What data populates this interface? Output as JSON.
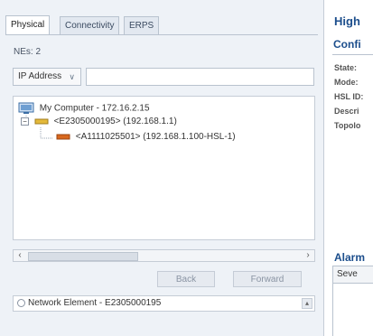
{
  "tabs": [
    {
      "label": "Physical"
    },
    {
      "label": "Connectivity"
    },
    {
      "label": "ERPS"
    }
  ],
  "nes_count": "NEs: 2",
  "filter": {
    "field": "IP Address",
    "value": ""
  },
  "tree": {
    "root": "My Computer - 172.16.2.15",
    "child": "<E2305000195> (192.168.1.1)",
    "grandchild": "<A1111025501> (192.168.1.100-HSL-1)"
  },
  "nav": {
    "back": "Back",
    "forward": "Forward"
  },
  "selected_ne": "Network Element - E2305000195",
  "right_panel": {
    "title": "High",
    "section": "Confi",
    "fields": [
      "State:",
      "Mode:",
      "HSL ID:",
      "Descri",
      "Topolo"
    ],
    "alarm_title": "Alarm",
    "severity_header": "Seve"
  },
  "colors": {
    "panel_bg": "#eef2f7",
    "title_blue": "#1c4e8c",
    "ne_icon_yellow": "#e4b93a",
    "ne_icon_orange": "#d8681e"
  }
}
